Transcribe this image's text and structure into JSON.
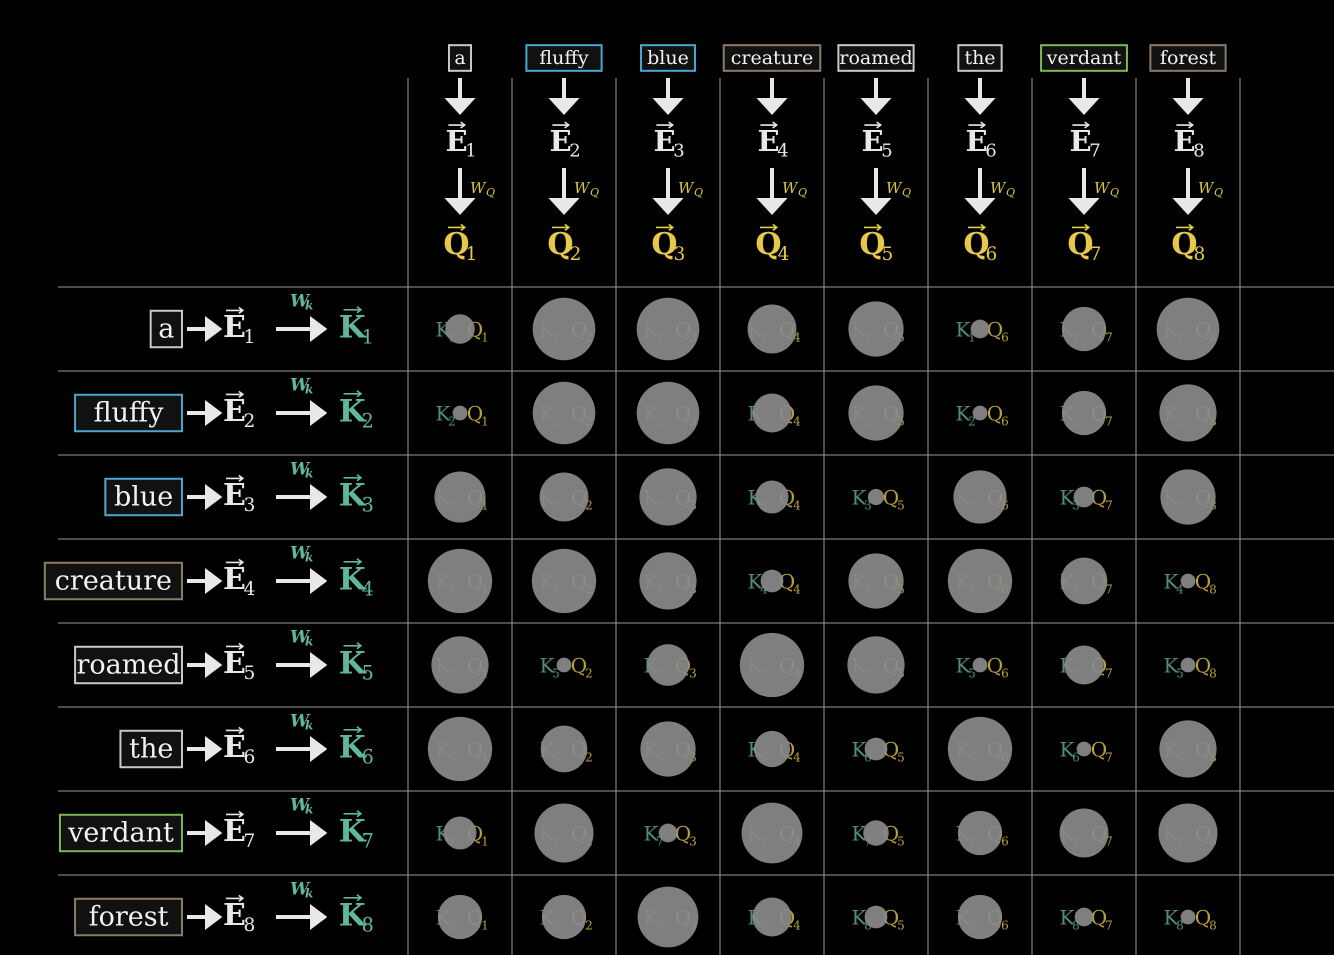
{
  "colors": {
    "background": "#000000",
    "query": "#e6c84a",
    "key": "#5fb89a",
    "embedding": "#e8e8e8",
    "circle": "#8a8a8a"
  },
  "weights": {
    "query_label": "W",
    "query_sub": "Q",
    "key_label": "W",
    "key_sub": "k"
  },
  "symbols": {
    "embedding": "E",
    "query": "Q",
    "key": "K",
    "dot": "·"
  },
  "tokens": [
    {
      "word": "a",
      "border": "#c8c8c8",
      "index": "1"
    },
    {
      "word": "fluffy",
      "border": "#4aa8d0",
      "index": "2"
    },
    {
      "word": "blue",
      "border": "#4aa8d0",
      "index": "3"
    },
    {
      "word": "creature",
      "border": "#8a7a6a",
      "index": "4"
    },
    {
      "word": "roamed",
      "border": "#c8c8c8",
      "index": "5"
    },
    {
      "word": "the",
      "border": "#c8c8c8",
      "index": "6"
    },
    {
      "word": "verdant",
      "border": "#7ab85a",
      "index": "7"
    },
    {
      "word": "forest",
      "border": "#8a7a6a",
      "index": "8"
    }
  ],
  "attention_grid": [
    [
      0.2,
      0.9,
      0.9,
      0.55,
      0.7,
      0.08,
      0.45,
      0.9
    ],
    [
      0.05,
      0.9,
      0.9,
      0.35,
      0.7,
      0.05,
      0.45,
      0.75
    ],
    [
      0.6,
      0.55,
      0.75,
      0.25,
      0.06,
      0.65,
      0.1,
      0.7
    ],
    [
      0.95,
      0.95,
      0.75,
      0.12,
      0.7,
      0.95,
      0.5,
      0.05
    ],
    [
      0.75,
      0.05,
      0.4,
      0.95,
      0.75,
      0.05,
      0.35,
      0.05
    ],
    [
      0.95,
      0.5,
      0.7,
      0.3,
      0.12,
      0.95,
      0.05,
      0.75
    ],
    [
      0.25,
      0.8,
      0.08,
      0.85,
      0.15,
      0.45,
      0.55,
      0.8
    ],
    [
      0.45,
      0.45,
      0.85,
      0.35,
      0.12,
      0.45,
      0.08,
      0.05
    ]
  ]
}
